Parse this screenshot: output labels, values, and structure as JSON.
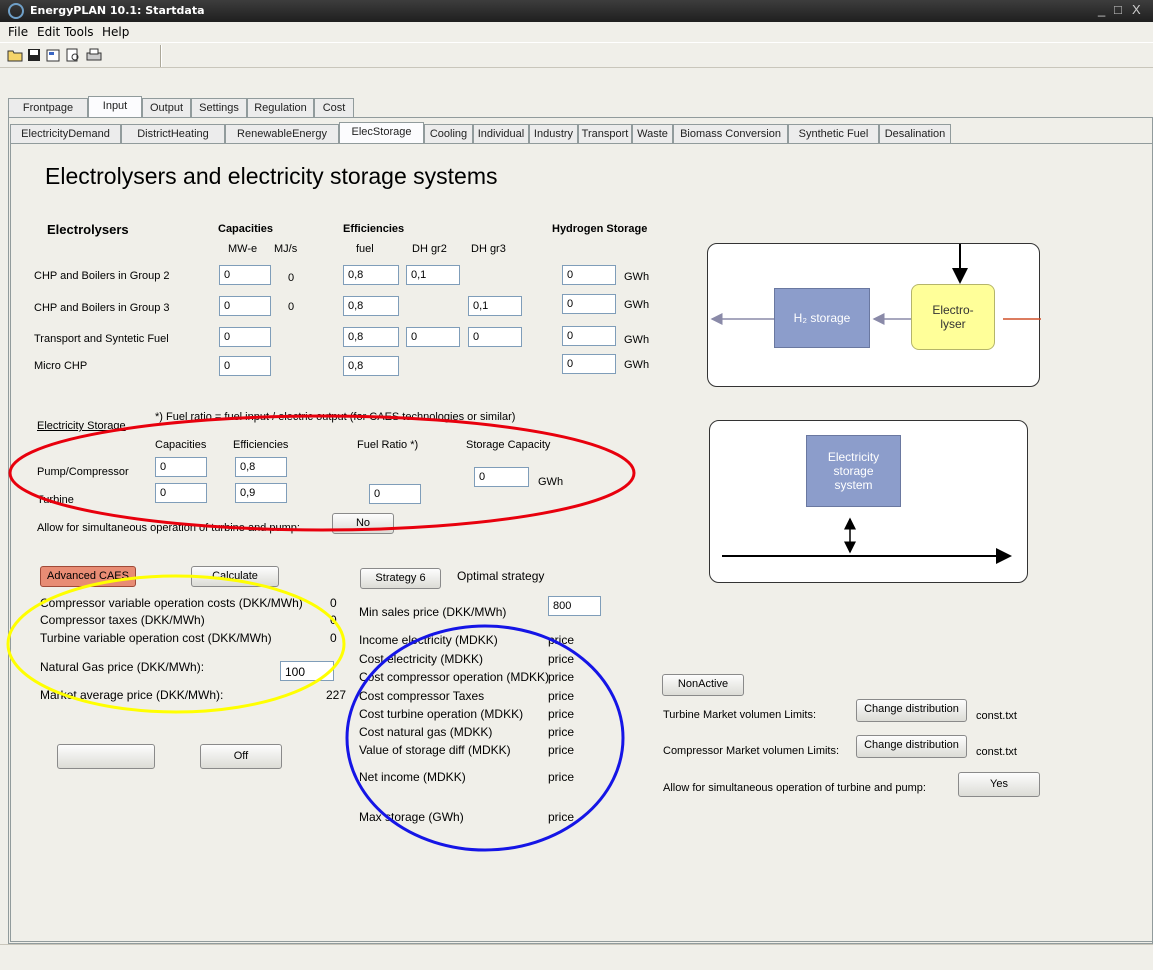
{
  "window": {
    "title": "EnergyPLAN 10.1: Startdata",
    "controls": [
      "_",
      "□",
      "X"
    ]
  },
  "menu": [
    "File",
    "Edit",
    "Tools",
    "Help"
  ],
  "toolbar": [
    "open-folder-icon",
    "save-icon",
    "properties-icon",
    "print-preview-icon",
    "print-icon"
  ],
  "main_tabs": [
    "Frontpage",
    "Input",
    "Output",
    "Settings",
    "Regulation",
    "Cost"
  ],
  "sub_tabs": [
    "ElectricityDemand",
    "DistrictHeating",
    "RenewableEnergy",
    "ElecStorage",
    "Cooling",
    "Individual",
    "Industry",
    "Transport",
    "Waste",
    "Biomass Conversion",
    "Synthetic Fuel",
    "Desalination"
  ],
  "page_title": "Electrolysers and electricity storage systems",
  "electrolysers": {
    "heading": "Electrolysers",
    "capacities": "Capacities",
    "efficiencies": "Efficiencies",
    "hydrogen_storage": "Hydrogen Storage",
    "col_mwe": "MW-e",
    "col_mjs": "MJ/s",
    "col_fuel": "fuel",
    "col_dh2": "DH gr2",
    "col_dh3": "DH gr3",
    "unit": "GWh",
    "rows": [
      {
        "label": "CHP and Boilers in Group 2",
        "mwe": "0",
        "mjs": "0",
        "fuel": "0,8",
        "dh2": "0,1",
        "dh3": null,
        "storage": "0"
      },
      {
        "label": "CHP and Boilers in Group 3",
        "mwe": "0",
        "mjs": "0",
        "fuel": "0,8",
        "dh2": null,
        "dh3": "0,1",
        "storage": "0"
      },
      {
        "label": "Transport and Syntetic Fuel",
        "mwe": "0",
        "mjs": null,
        "fuel": "0,8",
        "dh2": "0",
        "dh3": "0",
        "storage": "0"
      },
      {
        "label": "Micro CHP",
        "mwe": "0",
        "mjs": null,
        "fuel": "0,8",
        "dh2": null,
        "dh3": null,
        "storage": "0"
      }
    ]
  },
  "diagram1": {
    "h2": "H₂ storage",
    "electrolyser": "Electro-\nlyser"
  },
  "elec_storage": {
    "heading": "Electricity Storage",
    "note": "*) Fuel ratio = fuel input / electric output (for CAES technologies or similar)",
    "col_cap": "Capacities",
    "col_eff": "Efficiencies",
    "col_fuel": "Fuel Ratio *)",
    "col_storage": "Storage Capacity",
    "pump_label": "Pump/Compressor",
    "pump_cap": "0",
    "pump_eff": "0,8",
    "turbine_label": "Turbine",
    "turbine_cap": "0",
    "turbine_eff": "0,9",
    "turbine_fuel": "0",
    "storage_cap": "0",
    "storage_unit": "GWh",
    "simul_label": "Allow for simultaneous operation of turbine and pump:",
    "simul_value": "No"
  },
  "diagram2": {
    "label": "Electricity\nstorage\nsystem"
  },
  "caes": {
    "advanced": "Advanced CAES",
    "calculate": "Calculate",
    "rows": [
      {
        "label": "Compressor variable operation costs (DKK/MWh)",
        "value": "0"
      },
      {
        "label": "Compressor taxes  (DKK/MWh)",
        "value": "0"
      },
      {
        "label": "Turbine variable operation cost (DKK/MWh)",
        "value": "0"
      }
    ],
    "gas_label": "Natural Gas price (DKK/MWh):",
    "gas_value": "100",
    "market_label": "Market average price (DKK/MWh):",
    "market_value": "227",
    "blank_button": "",
    "off_button": "Off"
  },
  "strategy": {
    "button": "Strategy 6",
    "label": "Optimal strategy",
    "min_sales_label": "Min sales price (DKK/MWh)",
    "min_sales_value": "800",
    "results": [
      {
        "label": "Income electricity (MDKK)",
        "value": "price"
      },
      {
        "label": "Cost electricity (MDKK)",
        "value": "price"
      },
      {
        "label": "Cost compressor operation (MDKK)",
        "value": "price"
      },
      {
        "label": "Cost compressor Taxes",
        "value": "price"
      },
      {
        "label": "Cost turbine operation (MDKK)",
        "value": "price"
      },
      {
        "label": "Cost natural gas (MDKK)",
        "value": "price"
      },
      {
        "label": "Value of storage diff (MDKK)",
        "value": "price"
      },
      {
        "label": "Net income (MDKK)",
        "value": "price"
      },
      {
        "label": "Max storage (GWh)",
        "value": "price"
      }
    ]
  },
  "market": {
    "nonactive": "NonActive",
    "turbine_label": "Turbine Market volumen Limits:",
    "compressor_label": "Compressor Market volumen Limits:",
    "change_button": "Change distribution",
    "file": "const.txt",
    "simul_label": "Allow for simultaneous operation of turbine and pump:",
    "simul_value": "Yes"
  },
  "colors": {
    "red_ellipse": "#e8000d",
    "yellow_ellipse": "#ffff00",
    "blue_ellipse": "#1515e6",
    "h2_box": "#8c9dcb",
    "electrolyser_box": "#ffff99",
    "storage_box": "#8c9dcb",
    "advanced_btn": "#e88c74"
  }
}
